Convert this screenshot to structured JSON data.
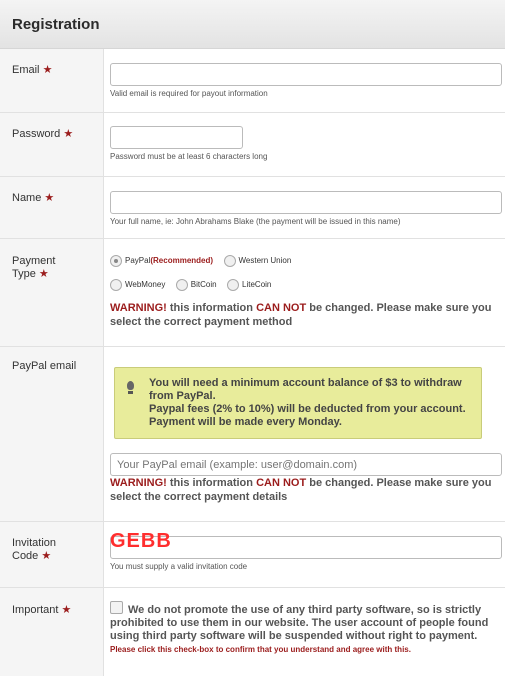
{
  "header": {
    "title": "Registration"
  },
  "required_mark": "★",
  "email": {
    "label": "Email",
    "value": "",
    "hint": "Valid email is required for payout information"
  },
  "password": {
    "label": "Password",
    "value": "",
    "hint": "Password must be at least 6 characters long"
  },
  "name": {
    "label": "Name",
    "value": "",
    "hint": "Your full name, ie: John Abrahams Blake (the payment will be issued in this name)"
  },
  "payment_type": {
    "label_line1": "Payment",
    "label_line2": "Type",
    "options": [
      "PayPal",
      "Western Union",
      "WebMoney",
      "BitCoin",
      "LiteCoin"
    ],
    "recommended": "(Recommended)",
    "selected": "PayPal",
    "warning_prefix": "WARNING!",
    "warning_mid": " this information ",
    "warning_cannot": "CAN NOT",
    "warning_rest": " be changed. Please make sure you select the correct payment method"
  },
  "paypal_email": {
    "label": "PayPal email",
    "notice_line1": "You will need a minimum account balance of $3 to withdraw from PayPal.",
    "notice_line2": "Paypal fees (2% to 10%) will be deducted from your account.",
    "notice_line3": "Payment will be made every Monday.",
    "placeholder": "Your PayPal email (example: user@domain.com)",
    "warning_prefix": "WARNING!",
    "warning_mid": " this information ",
    "warning_cannot": "CAN NOT",
    "warning_rest": " be changed. Please make sure you select the correct payment details"
  },
  "invitation": {
    "label_line1": "Invitation",
    "label_line2": "Code",
    "overlay_text": "GEBB",
    "hint": "You must supply a valid invitation code"
  },
  "important": {
    "label": "Important",
    "text": "We do not promote the use of any third party software, so is strictly prohibited to use them in our website. The user account of people found using third party software will be suspended without right to payment.",
    "confirm": "Please click this check-box to confirm that you understand and agree with this."
  },
  "colors": {
    "accent_red": "#9b1c1c",
    "notice_bg": "#e8ec9b",
    "overlay_red": "#ff2e2e"
  }
}
